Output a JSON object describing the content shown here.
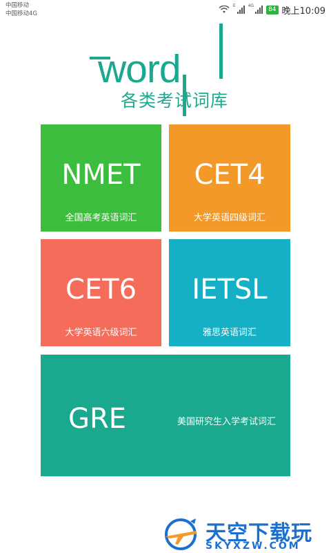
{
  "status_bar": {
    "carrier_1": "中国移动",
    "carrier_2": "中国移动4G",
    "network_label": "4G",
    "battery": "84",
    "time": "晚上10:09"
  },
  "logo": {
    "word": "word",
    "subtitle": "各类考试词库"
  },
  "tiles": [
    {
      "title": "NMET",
      "subtitle": "全国高考英语词汇",
      "color": "#3dbd3d"
    },
    {
      "title": "CET4",
      "subtitle": "大学英语四级词汇",
      "color": "#f2992a"
    },
    {
      "title": "CET6",
      "subtitle": "大学英语六级词汇",
      "color": "#f56c5b"
    },
    {
      "title": "IETSL",
      "subtitle": "雅思英语词汇",
      "color": "#16b0c6"
    },
    {
      "title": "GRE",
      "subtitle": "美国研究生入学考试词汇",
      "color": "#1aa98f"
    }
  ],
  "watermark": {
    "brand": "天空下载玩",
    "domain": "SKYXZW.COM"
  }
}
